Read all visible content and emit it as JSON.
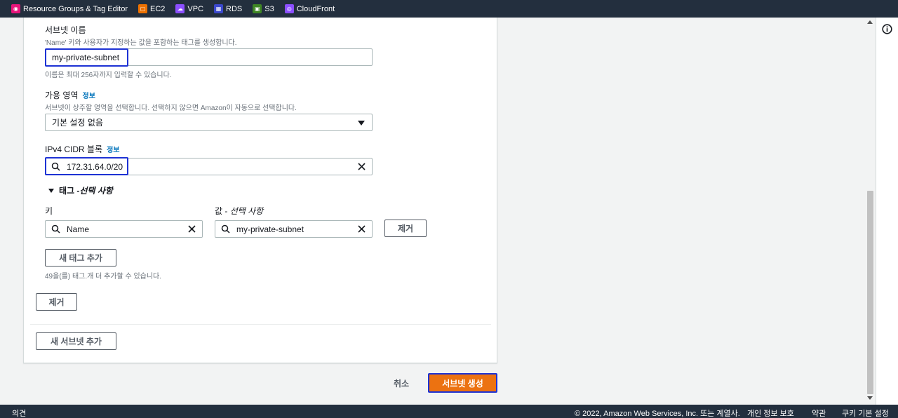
{
  "favorites": [
    {
      "label": "Resource Groups & Tag Editor",
      "icon": "resource-groups-icon",
      "color": "#e7157b"
    },
    {
      "label": "EC2",
      "icon": "ec2-icon",
      "color": "#ed7100"
    },
    {
      "label": "VPC",
      "icon": "vpc-icon",
      "color": "#8c4fff"
    },
    {
      "label": "RDS",
      "icon": "rds-icon",
      "color": "#3b48cc"
    },
    {
      "label": "S3",
      "icon": "s3-icon",
      "color": "#3f8624"
    },
    {
      "label": "CloudFront",
      "icon": "cloudfront-icon",
      "color": "#8c4fff"
    }
  ],
  "subnet_name": {
    "label": "서브넷 이름",
    "description": "'Name' 키와 사용자가 지정하는 값을 포함하는 태그를 생성합니다.",
    "value": "my-private-subnet",
    "constraint": "이름은 최대 256자까지 입력할 수 있습니다."
  },
  "availability_zone": {
    "label": "가용 영역",
    "info": "정보",
    "description": "서브넷이 상주할 영역을 선택합니다. 선택하지 않으면 Amazon이 자동으로 선택합니다.",
    "selected": "기본 설정 없음"
  },
  "ipv4_cidr": {
    "label": "IPv4 CIDR 블록",
    "info": "정보",
    "value": "172.31.64.0/20"
  },
  "tags": {
    "section_label_prefix": "태그 - ",
    "section_label_optional": "선택 사항",
    "key_label": "키",
    "value_label_prefix": "값 - ",
    "value_label_optional": "선택 사항",
    "key_value": "Name",
    "value_value": "my-private-subnet",
    "remove_label": "제거",
    "add_label": "새 태그 추가",
    "remaining_note": "49을(를) 태그.개 더 추가할 수 있습니다."
  },
  "remove_subnet_label": "제거",
  "add_subnet_label": "새 서브넷 추가",
  "cancel_label": "취소",
  "create_label": "서브넷 생성",
  "footer": {
    "feedback": "의견",
    "copyright": "© 2022, Amazon Web Services, Inc. 또는 계열사.",
    "privacy": "개인 정보 보호",
    "terms": "약관",
    "cookies": "쿠키 기본 설정"
  },
  "colors": {
    "primary": "#ec7211",
    "focus": "#1d32d4",
    "link": "#0073bb",
    "navbar": "#232f3e"
  }
}
